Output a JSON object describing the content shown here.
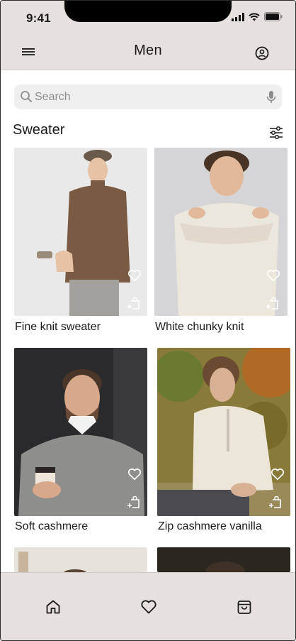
{
  "status_bar": {
    "time": "9:41"
  },
  "header": {
    "title": "Men",
    "menu_icon": "hamburger-menu-icon",
    "profile_icon": "user-circle-icon"
  },
  "search": {
    "placeholder": "Search",
    "value": "",
    "search_icon": "magnifier-icon",
    "mic_icon": "microphone-icon"
  },
  "section": {
    "title": "Sweater",
    "filter_icon": "sliders-filter-icon"
  },
  "products": [
    {
      "name": "Fine knit sweater",
      "sweater_color": "#7a5a42",
      "backdrop": "#e9e9ea"
    },
    {
      "name": "White chunky knit",
      "sweater_color": "#ece7dd",
      "backdrop": "#d5d5d7"
    },
    {
      "name": "Soft cashmere",
      "sweater_color": "#8e8e8c",
      "backdrop": "#2a2a2c"
    },
    {
      "name": "Zip cashmere vanilla",
      "sweater_color": "#ece6d8",
      "backdrop": "#8a7a3a"
    }
  ],
  "bottom_nav": [
    {
      "id": "home",
      "icon": "home-icon"
    },
    {
      "id": "favorites",
      "icon": "heart-icon"
    },
    {
      "id": "bag",
      "icon": "shopping-bag-icon"
    }
  ],
  "colors": {
    "header_bg": "#e6e1df",
    "search_bg": "#efefef",
    "text": "#1a1a1a"
  }
}
